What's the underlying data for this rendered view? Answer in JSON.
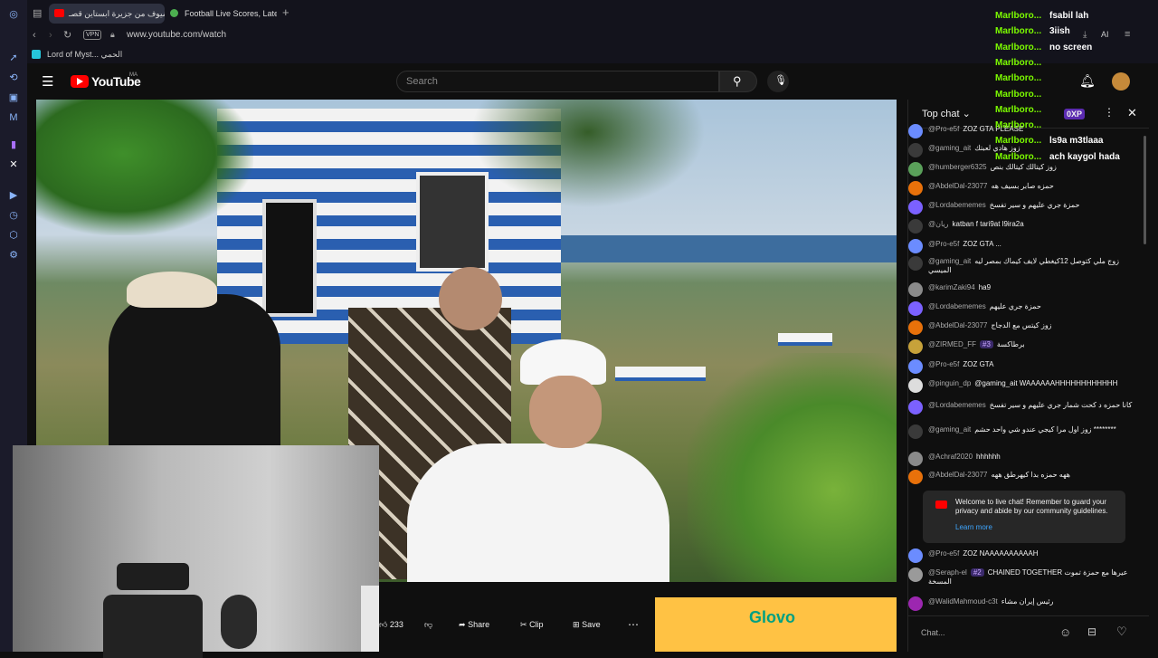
{
  "browser": {
    "tabs": [
      {
        "label": "ضيوف من جزيرة ابستاين قصـ",
        "active": true
      },
      {
        "label": "Football Live Scores, Late",
        "active": false
      }
    ],
    "new_tab": "+",
    "vpn_badge": "VPN",
    "url": "www.youtube.com/watch",
    "bookmark": "Lord of Myst... الحمي",
    "ai_label": "AI"
  },
  "youtube": {
    "logo": "YouTube",
    "country": "MA",
    "search_placeholder": "Search"
  },
  "video_actions": {
    "likes": "233",
    "share": "Share",
    "clip": "Clip",
    "save": "Save"
  },
  "ad": {
    "brand": "Glovo"
  },
  "chat": {
    "mode": "Top chat",
    "xp": "0XP",
    "welcome": "Welcome to live chat! Remember to guard your privacy and abide by our community guidelines.",
    "learn_more": "Learn more",
    "input_placeholder": "Chat...",
    "messages": [
      {
        "author": "@Pro-e5f",
        "text": "ZOZ GTA PLEASE",
        "color": "#6b8cff"
      },
      {
        "author": "@gaming_ait",
        "text": "زوز هادي لعبتك",
        "color": "#3a3a3a"
      },
      {
        "author": "@humberger6325",
        "text": "زوز كيتالك كيتالك بنص",
        "color": "#5aa05a"
      },
      {
        "author": "@AbdelDal-23077",
        "text": "حمزه صابر بسيف هه",
        "color": "#e8710a"
      },
      {
        "author": "@Lordabememes",
        "text": "حمزة جري عليهم و سير تفسخ",
        "color": "#7b61ff"
      },
      {
        "author": "@ريان",
        "text": "katban f tari9at l9ira2a",
        "color": "#3a3a3a"
      },
      {
        "author": "@Pro-e5f",
        "text": "ZOZ GTA ...",
        "color": "#6b8cff"
      },
      {
        "author": "@gaming_ait",
        "text": "زوج ملي كتوصل 12كيغطي لايف كيماك بمصر ليه الميسي",
        "color": "#3a3a3a"
      },
      {
        "author": "@karimZaki94",
        "text": "ha9",
        "color": "#8a8a8a"
      },
      {
        "author": "@Lordabememes",
        "text": "حمزة جري عليهم",
        "color": "#7b61ff"
      },
      {
        "author": "@AbdelDal-23077",
        "text": "زوز كيتس مع الدجاج",
        "color": "#e8710a"
      },
      {
        "author": "@ZIRMED_FF",
        "badge": "#3",
        "text": "برطاكسة",
        "color": "#c7a23a"
      },
      {
        "author": "@Pro-e5f",
        "text": "ZOZ GTA",
        "color": "#6b8cff"
      },
      {
        "author": "@pinguin_dp",
        "text": "@gaming_ait WAAAAAAHHHHHHHHHHHH",
        "color": "#dddddd"
      },
      {
        "author": "@Lordabememes",
        "text": "كانا حمزه د كحت شمار جري عليهم و سير تفسخ",
        "color": "#7b61ff"
      },
      {
        "author": "@gaming_ait",
        "text": "زوز اول مرا كيجي عندو شي واحد حشم ********",
        "color": "#3a3a3a"
      },
      {
        "author": "@Achraf2020",
        "text": "hhhhhh",
        "color": "#8a8a8a"
      },
      {
        "author": "@AbdelDal-23077",
        "text": "ههه حمزه بدا كيهرطق ههه",
        "color": "#e8710a"
      },
      {
        "author": "@Pro-e5f",
        "text": "ZOZ NAAAAAAAAAAH",
        "color": "#6b8cff"
      },
      {
        "author": "@Seraph-el",
        "badge": "#2",
        "text": "CHAINED TOGETHER عيرها مع حمزة تموت المسخة",
        "color": "#9a9a9a"
      },
      {
        "author": "@WalidMahmoud-c3t",
        "text": "رئيس إيران مشاء",
        "color": "#9c27b0"
      }
    ]
  },
  "overlay": {
    "name": "Marlboro...",
    "lines": [
      "fsabil lah",
      "3iish",
      "no screen",
      "",
      "",
      "",
      "",
      "",
      "ls9a m3tlaaa",
      "ach kaygol hada"
    ]
  }
}
